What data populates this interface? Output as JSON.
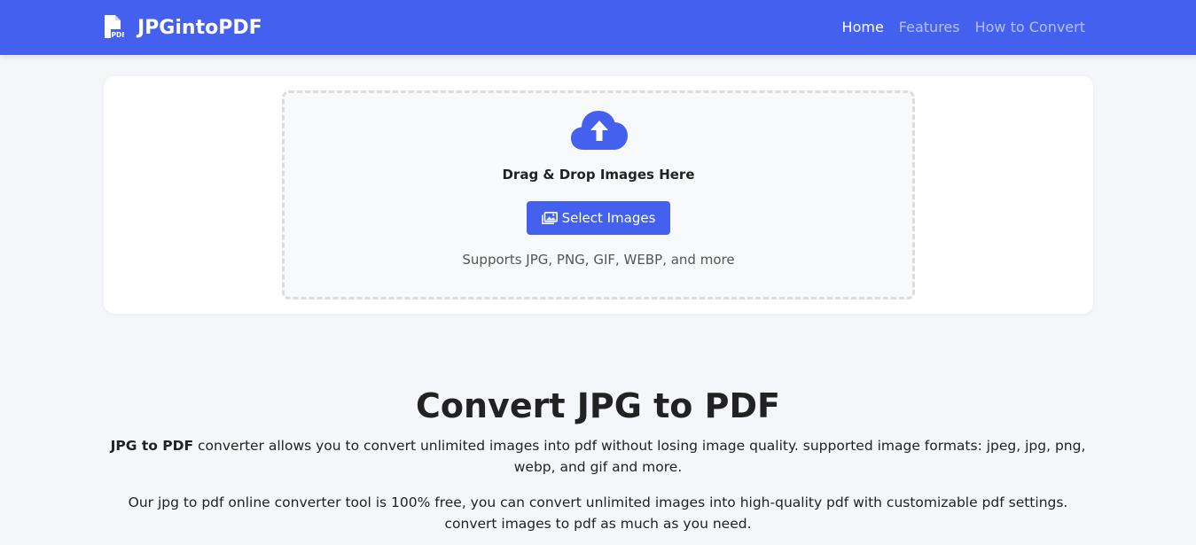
{
  "header": {
    "brand": "JPGintoPDF",
    "brand_icon": "pdf-file-icon",
    "nav": [
      {
        "label": "Home",
        "active": true
      },
      {
        "label": "Features",
        "active": false
      },
      {
        "label": "How to Convert",
        "active": false
      }
    ]
  },
  "upload": {
    "cloud_icon": "cloud-upload-icon",
    "title": "Drag & Drop Images Here",
    "button_label": "Select Images",
    "button_icon": "images-icon",
    "supports": "Supports JPG, PNG, GIF, WEBP, and more"
  },
  "content": {
    "heading": "Convert JPG to PDF",
    "para1_bold": "JPG to PDF",
    "para1_rest": " converter allows you to convert unlimited images into pdf without losing image quality. supported image formats: jpeg, jpg, png, webp, and gif and more.",
    "para2": "Our jpg to pdf online converter tool is 100% free, you can convert unlimited images into high-quality pdf with customizable pdf settings. convert images to pdf as much as you need."
  },
  "colors": {
    "primary": "#4361ee",
    "background": "#f5f6fa",
    "card": "#ffffff"
  }
}
